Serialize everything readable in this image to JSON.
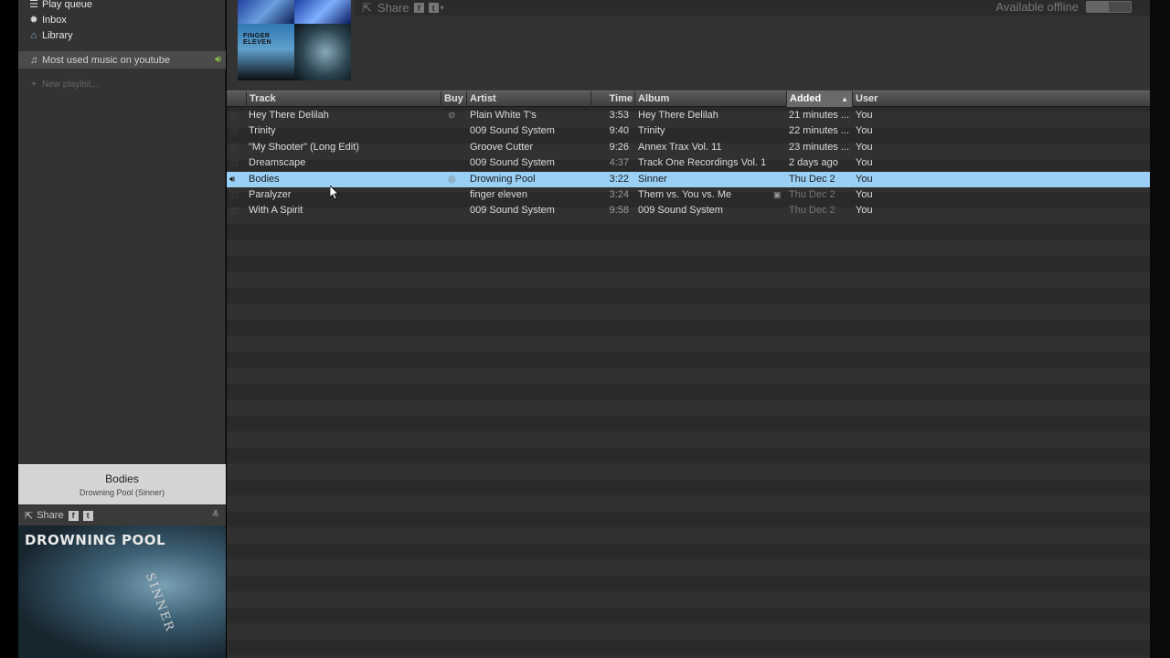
{
  "sidebar": {
    "nav": [
      {
        "label": "Play queue",
        "icon": "queue-icon"
      },
      {
        "label": "Inbox",
        "icon": "inbox-icon"
      },
      {
        "label": "Library",
        "icon": "library-icon"
      }
    ],
    "active_playlist": "Most used music on youtube",
    "new_playlist": "New playlist..."
  },
  "now_playing": {
    "title": "Bodies",
    "subtitle": "Drowning Pool (Sinner)",
    "share_label": "Share",
    "album_band": "DROWNING POOL",
    "album_title": "SINNER"
  },
  "header": {
    "share_label": "Share",
    "offline_label": "Available offline",
    "cover_text": "FINGER ELEVEN"
  },
  "table": {
    "columns": {
      "track": "Track",
      "buy": "Buy",
      "artist": "Artist",
      "time": "Time",
      "album": "Album",
      "added": "Added",
      "user": "User"
    },
    "rows": [
      {
        "track": "Hey There Delilah",
        "artist": "Plain White T's",
        "time": "3:53",
        "album": "Hey There Delilah",
        "added": "21 minutes ...",
        "user": "You"
      },
      {
        "track": "Trinity",
        "artist": "009 Sound System",
        "time": "9:40",
        "album": "Trinity",
        "added": "22 minutes ...",
        "user": "You"
      },
      {
        "track": "\"My Shooter\" (Long Edit)",
        "artist": "Groove Cutter",
        "time": "9:26",
        "album": "Annex Trax Vol. 11",
        "added": "23 minutes ...",
        "user": "You"
      },
      {
        "track": "Dreamscape",
        "artist": "009 Sound System",
        "time": "4:37",
        "album": "Track One Recordings Vol. 1",
        "added": "2 days ago",
        "user": "You"
      },
      {
        "track": "Bodies",
        "artist": "Drowning Pool",
        "time": "3:22",
        "album": "Sinner",
        "added": "Thu Dec 2",
        "user": "You"
      },
      {
        "track": "Paralyzer",
        "artist": "finger eleven",
        "time": "3:24",
        "album": "Them vs. You vs. Me",
        "added": "Thu Dec 2",
        "user": "You"
      },
      {
        "track": "With A Spirit",
        "artist": "009 Sound System",
        "time": "9:58",
        "album": "009 Sound System",
        "added": "Thu Dec 2",
        "user": "You"
      }
    ]
  }
}
